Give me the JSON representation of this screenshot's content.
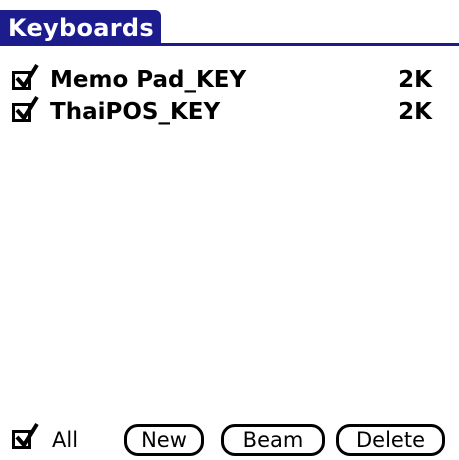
{
  "app": {
    "title": "Keyboards"
  },
  "keyboards": [
    {
      "name": "Memo Pad_KEY",
      "size": "2K",
      "checked": true
    },
    {
      "name": "ThaiPOS_KEY",
      "size": "2K",
      "checked": true
    }
  ],
  "footer": {
    "all_label": "All",
    "all_checked": true,
    "new_label": "New",
    "beam_label": "Beam",
    "delete_label": "Delete"
  },
  "colors": {
    "title_bar": "#1c1c8c",
    "title_text": "#ffffff",
    "background": "#ffffff",
    "text": "#000000"
  }
}
